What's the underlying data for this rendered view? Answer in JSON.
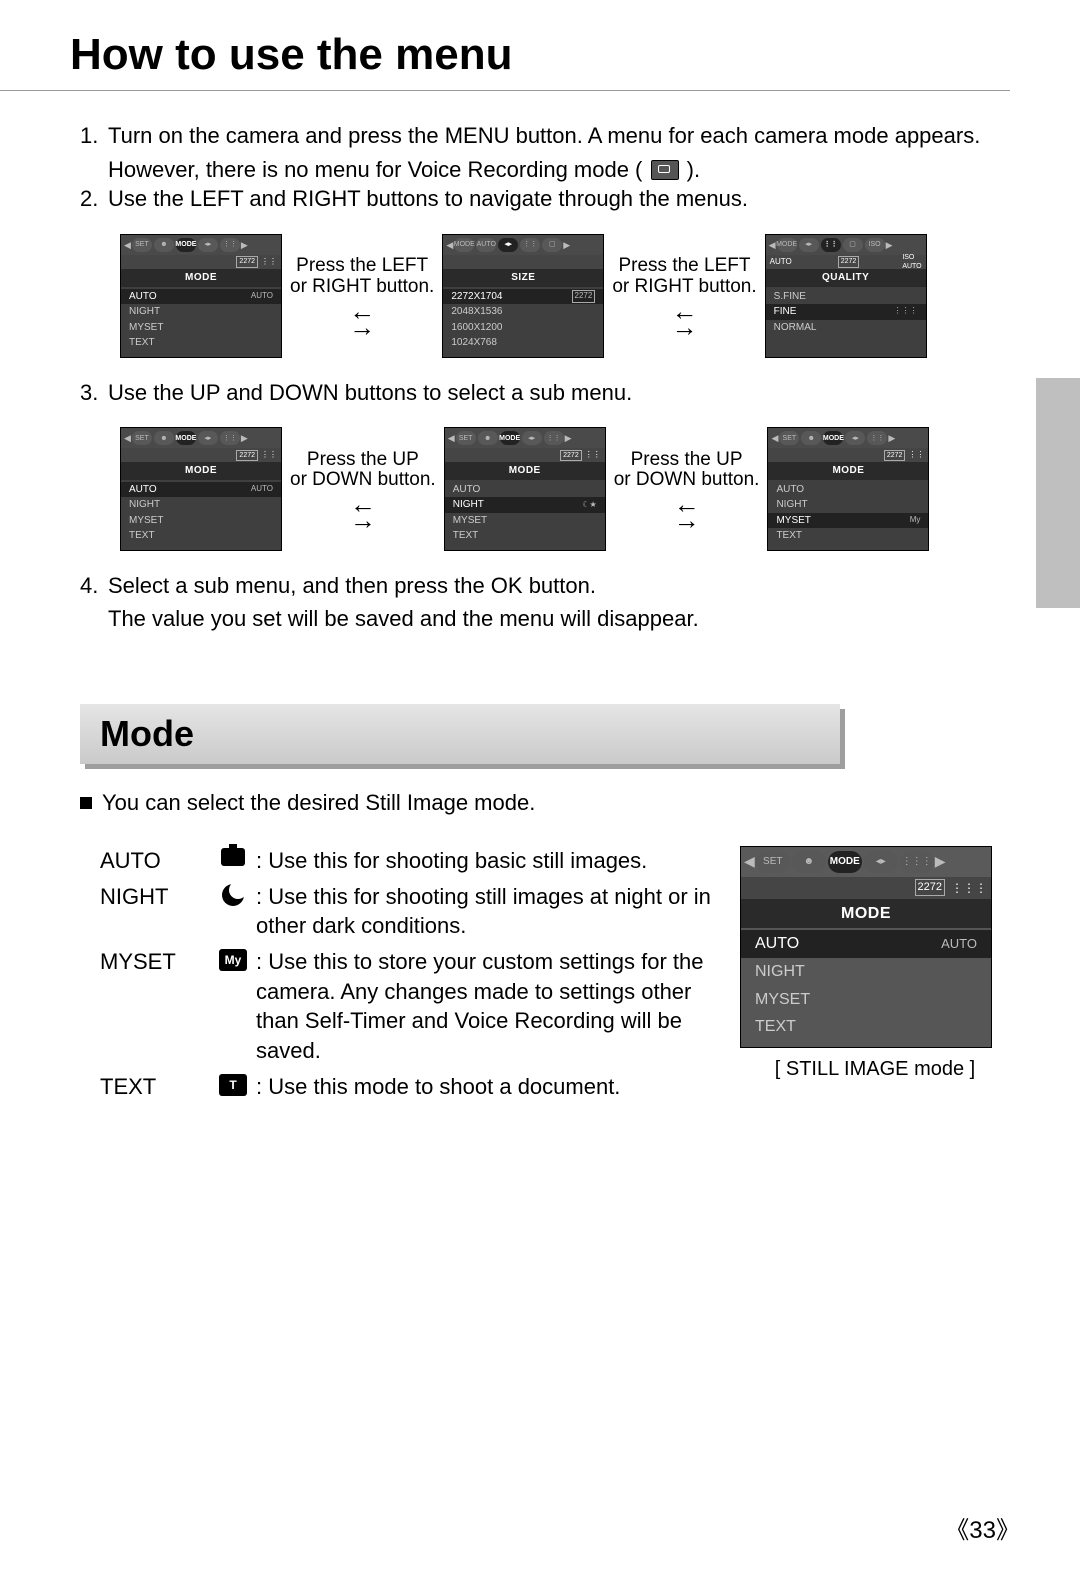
{
  "title": "How to use the menu",
  "steps": {
    "s1a": "Turn on the camera and press the MENU button. A menu for each camera mode appears.",
    "s1b": "However, there is no menu for Voice Recording mode (",
    "s1c": ").",
    "s2": "Use the LEFT and RIGHT buttons to navigate through the menus.",
    "s3": "Use the UP and DOWN buttons to select a sub menu.",
    "s4a": "Select a sub menu, and then press the OK button.",
    "s4b": "The value you set will be saved and the menu will disappear."
  },
  "nums": {
    "n1": "1.",
    "n2": "2.",
    "n3": "3.",
    "n4": "4."
  },
  "nav_labels": {
    "lr1": "Press the LEFT",
    "lr2": "or RIGHT button.",
    "ud1": "Press the UP",
    "ud2": "or DOWN button."
  },
  "tabs": {
    "set": "SET",
    "mode": "MODE",
    "auto": "AUTO",
    "iso": "ISO"
  },
  "sizebar": {
    "val": "2272",
    "grid": "⋮⋮⋮"
  },
  "screen_mode": {
    "title": "MODE",
    "items": [
      "AUTO",
      "NIGHT",
      "MYSET",
      "TEXT"
    ],
    "tag_auto": "AUTO",
    "tag_night": "",
    "tag_my": "My"
  },
  "screen_size": {
    "title": "SIZE",
    "items": [
      "2272X1704",
      "2048X1536",
      "1600X1200",
      "1024X768"
    ],
    "tag": "2272"
  },
  "screen_quality": {
    "title": "QUALITY",
    "items": [
      "S.FINE",
      "FINE",
      "NORMAL"
    ],
    "tag_fine": "⋮⋮⋮"
  },
  "mode_section": {
    "heading": "Mode",
    "intro": "You can select the desired Still Image mode.",
    "auto_label": "AUTO",
    "auto_desc": ": Use this for shooting basic still images.",
    "night_label": "NIGHT",
    "night_desc": ": Use this for shooting still images at night or in other dark conditions.",
    "myset_label": "MYSET",
    "myset_icon": "My",
    "myset_desc": ": Use this to store your custom settings for the camera. Any changes made to settings other than Self-Timer and Voice Recording will be saved.",
    "text_label": "TEXT",
    "text_icon": "T",
    "text_desc": ": Use this mode to shoot a document.",
    "big_caption": "[ STILL IMAGE mode ]"
  },
  "page_number": "33"
}
